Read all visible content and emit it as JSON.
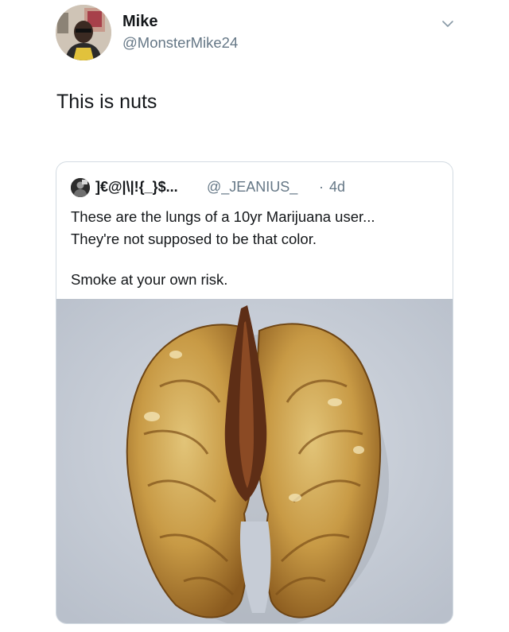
{
  "tweet": {
    "author": {
      "name": "Mike",
      "handle": "@MonsterMike24",
      "avatar_icon": "profile-photo"
    },
    "text": "This is nuts",
    "menu_icon": "chevron-down-icon",
    "quoted_tweet": {
      "author_name": "]€@|\\|!{_}$...",
      "author_handle": "@_JEANIUS_",
      "separator": "·",
      "time": "4d",
      "text_lines": [
        "These are the lungs of a 10yr Marijuana user...",
        "They're not supposed to be that color.",
        "Smoke at your own risk."
      ],
      "media_description_icon": "walnut-photo"
    }
  },
  "colors": {
    "text_primary": "#14171a",
    "text_secondary": "#657786",
    "card_border": "#d3dbe2",
    "photo_background": "#c6ccd6"
  }
}
